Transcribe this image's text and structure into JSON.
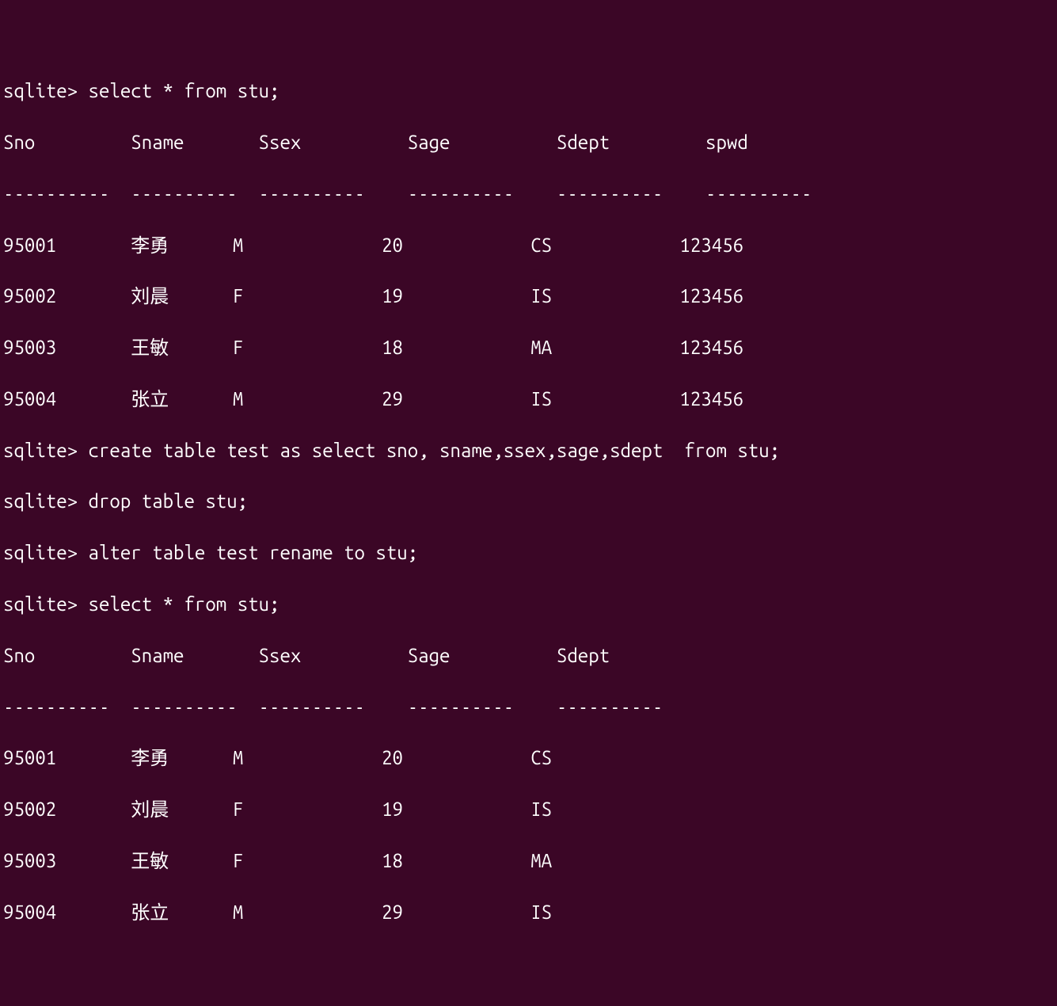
{
  "terminal": {
    "prompt": "sqlite> ",
    "commands": {
      "cmd1": "select * from stu;",
      "cmd2": "create table test as select sno, sname,ssex,sage,sdept  from stu;",
      "cmd3": "drop table stu;",
      "cmd4": "alter table test rename to stu;",
      "cmd5": "select * from stu;"
    },
    "table1": {
      "header": "Sno         Sname       Ssex          Sage          Sdept         spwd      ",
      "separator": "----------  ----------  ----------    ----------    ----------    ----------",
      "rows": [
        "95001       李勇      M             20            CS            123456    ",
        "95002       刘晨      F             19            IS            123456    ",
        "95003       王敏      F             18            MA            123456    ",
        "95004       张立      M             29            IS            123456    "
      ]
    },
    "table2": {
      "header": "Sno         Sname       Ssex          Sage          Sdept     ",
      "separator": "----------  ----------  ----------    ----------    ----------",
      "rows": [
        "95001       李勇      M             20            CS        ",
        "95002       刘晨      F             19            IS        ",
        "95003       王敏      F             18            MA        ",
        "95004       张立      M             29            IS        "
      ]
    }
  },
  "chart_data": [
    {
      "type": "table",
      "title": "stu (before)",
      "columns": [
        "Sno",
        "Sname",
        "Ssex",
        "Sage",
        "Sdept",
        "spwd"
      ],
      "rows": [
        [
          "95001",
          "李勇",
          "M",
          20,
          "CS",
          "123456"
        ],
        [
          "95002",
          "刘晨",
          "F",
          19,
          "IS",
          "123456"
        ],
        [
          "95003",
          "王敏",
          "F",
          18,
          "MA",
          "123456"
        ],
        [
          "95004",
          "张立",
          "M",
          29,
          "IS",
          "123456"
        ]
      ]
    },
    {
      "type": "table",
      "title": "stu (after)",
      "columns": [
        "Sno",
        "Sname",
        "Ssex",
        "Sage",
        "Sdept"
      ],
      "rows": [
        [
          "95001",
          "李勇",
          "M",
          20,
          "CS"
        ],
        [
          "95002",
          "刘晨",
          "F",
          19,
          "IS"
        ],
        [
          "95003",
          "王敏",
          "F",
          18,
          "MA"
        ],
        [
          "95004",
          "张立",
          "M",
          29,
          "IS"
        ]
      ]
    }
  ]
}
